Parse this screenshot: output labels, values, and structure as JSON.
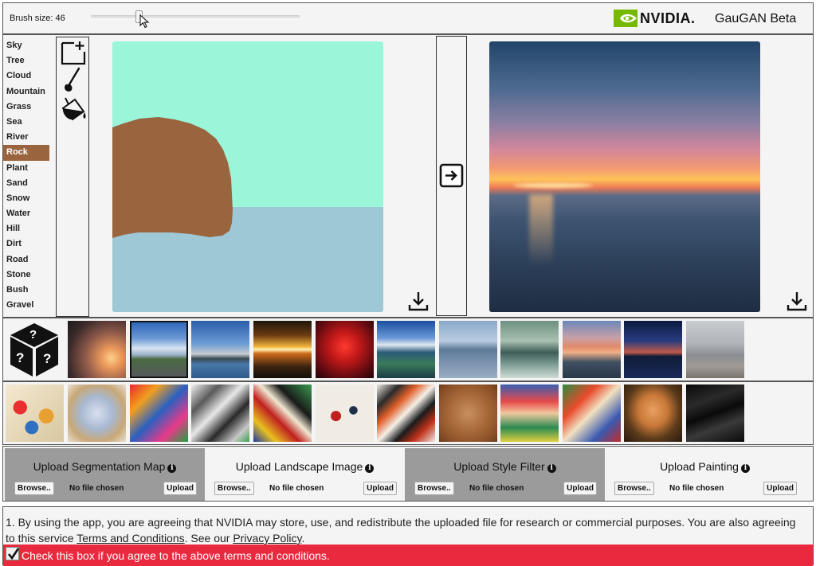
{
  "header": {
    "brush_size_label": "Brush size: 46",
    "brush_size": 46,
    "brand": "NVIDIA.",
    "app_title": "GauGAN Beta"
  },
  "labels": [
    "Sky",
    "Tree",
    "Cloud",
    "Mountain",
    "Grass",
    "Sea",
    "River",
    "Rock",
    "Plant",
    "Sand",
    "Snow",
    "Water",
    "Hill",
    "Dirt",
    "Road",
    "Stone",
    "Bush",
    "Gravel"
  ],
  "selected_label": "Rock",
  "colors": {
    "sky": "#9bf5d8",
    "sea": "#9ec8d6",
    "rock": "#9a643f",
    "upload_dark": "#9b9b9b",
    "agree_bar": "#e9293e",
    "nvidia_green": "#76b900"
  },
  "icons": {
    "tools": [
      "new-canvas-icon",
      "brush-icon",
      "fill-bucket-icon"
    ],
    "download": "download-icon",
    "generate": "arrow-right-icon",
    "random": "random-dice-icon",
    "info": "info-icon"
  },
  "uploads": [
    {
      "title": "Upload Segmentation Map",
      "info": "i",
      "browse": "Browse..",
      "status": "No file chosen",
      "upload": "Upload"
    },
    {
      "title": "Upload Landscape Image",
      "info": "i",
      "browse": "Browse..",
      "status": "No file chosen",
      "upload": "Upload"
    },
    {
      "title": "Upload Style Filter",
      "info": "i",
      "browse": "Browse..",
      "status": "No file chosen",
      "upload": "Upload"
    },
    {
      "title": "Upload Painting",
      "info": "i",
      "browse": "Browse..",
      "status": "No file chosen",
      "upload": "Upload"
    }
  ],
  "terms": {
    "text_1": "1. By using the app, you are agreeing that NVIDIA may store, use, and redistribute the uploaded file for research or commercial purposes. You are also agreeing to this service ",
    "terms_link": "Terms and Conditions",
    "text_2": ". See our ",
    "privacy_link": "Privacy Policy",
    "text_3": ".",
    "agree_label": "Check this box if you agree to the above terms and conditions.",
    "agree_checked": true
  }
}
